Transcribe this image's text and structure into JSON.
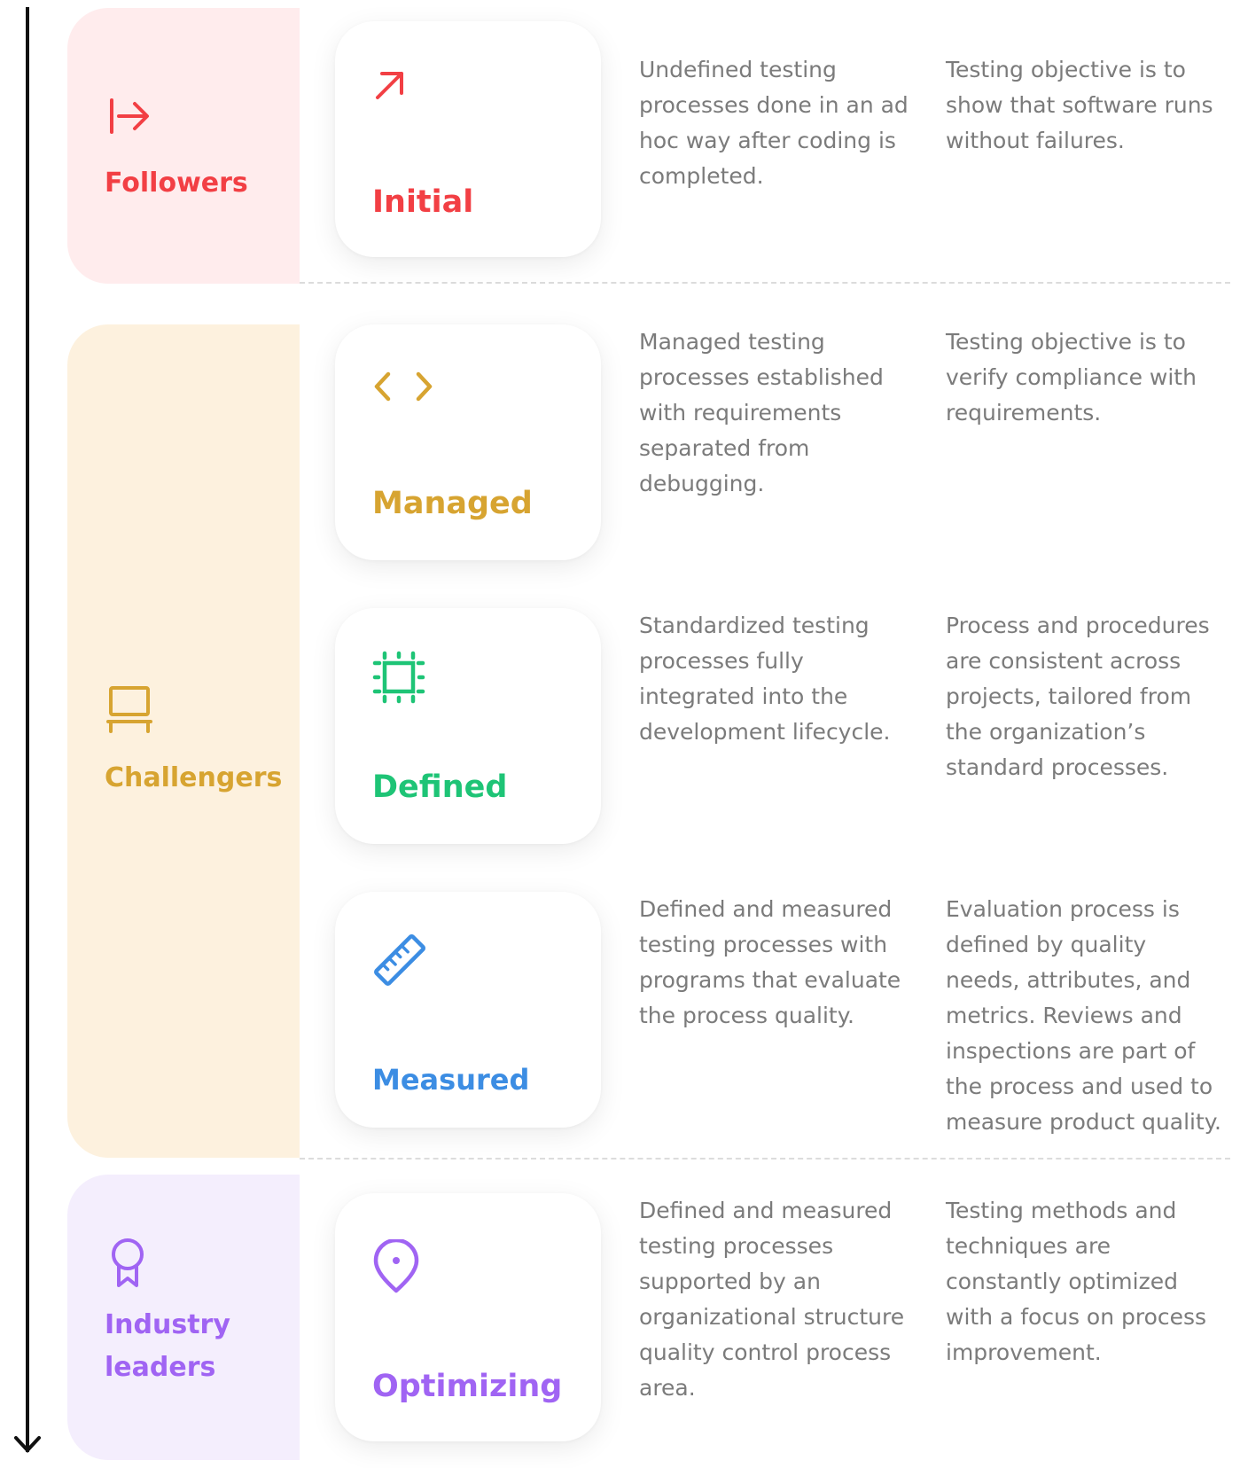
{
  "colors": {
    "followers": "#f23f44",
    "challengers": "#d7a431",
    "defined": "#1ec476",
    "measured": "#3c8de3",
    "leaders": "#a064f3"
  },
  "groups": [
    {
      "label": "Followers",
      "icon": "arrow-right-to-bar-icon"
    },
    {
      "label": "Challengers",
      "icon": "laptop-icon"
    },
    {
      "label_line1": "Industry",
      "label_line2": "leaders",
      "icon": "award-ribbon-icon"
    }
  ],
  "stages": [
    {
      "label": "Initial",
      "icon": "arrow-up-right-icon",
      "description": "Undefined testing\nprocesses done in an ad\nhoc way after coding is\ncompleted.",
      "objective": "Testing objective is to\nshow that software runs\nwithout failures."
    },
    {
      "label": "Managed",
      "icon": "code-brackets-icon",
      "description": "Managed testing\nprocesses established\nwith requirements\nseparated from\ndebugging.",
      "objective": "Testing objective is to\nverify compliance with\nrequirements."
    },
    {
      "label": "Defined",
      "icon": "crop-frame-icon",
      "description": "Standardized testing\nprocesses  fully\nintegrated into the\ndevelopment lifecycle.",
      "objective": "Process and procedures\nare consistent across\nprojects, tailored from\nthe organization’s\nstandard processes."
    },
    {
      "label": "Measured",
      "icon": "ruler-icon",
      "description": "Defined and measured\ntesting processes with\nprograms that evaluate\nthe process quality.",
      "objective": "Evaluation process is\ndefined by quality\nneeds, attributes, and\nmetrics. Reviews and\ninspections are part of\nthe process and used to\nmeasure product quality."
    },
    {
      "label": "Optimizing",
      "icon": "location-pin-icon",
      "description": "Defined and measured\ntesting processes\nsupported by an\norganizational structure\nquality control process\narea.",
      "objective": "Testing methods and\ntechniques are\nconstantly optimized\nwith a focus on process\nimprovement."
    }
  ]
}
